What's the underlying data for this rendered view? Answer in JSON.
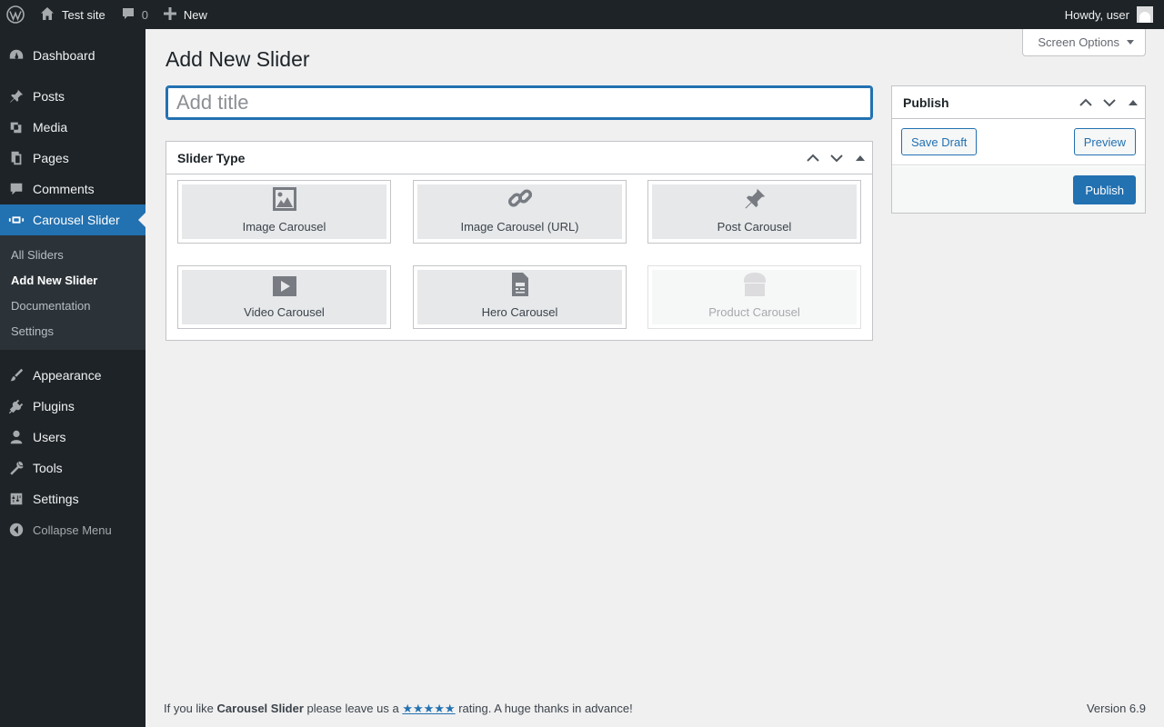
{
  "admin_bar": {
    "site_name": "Test site",
    "comments_count": "0",
    "new_label": "New",
    "greeting": "Howdy, user"
  },
  "sidebar": {
    "items_top": [
      {
        "label": "Dashboard",
        "icon": "dashboard-icon"
      }
    ],
    "items_mid": [
      {
        "label": "Posts",
        "icon": "pushpin-icon"
      },
      {
        "label": "Media",
        "icon": "media-icon"
      },
      {
        "label": "Pages",
        "icon": "pages-icon"
      },
      {
        "label": "Comments",
        "icon": "comments-icon"
      },
      {
        "label": "Carousel Slider",
        "icon": "slides-icon",
        "current": true
      }
    ],
    "submenu": [
      {
        "label": "All Sliders"
      },
      {
        "label": "Add New Slider",
        "current": true
      },
      {
        "label": "Documentation"
      },
      {
        "label": "Settings"
      }
    ],
    "items_bottom": [
      {
        "label": "Appearance",
        "icon": "brush-icon"
      },
      {
        "label": "Plugins",
        "icon": "plugin-icon"
      },
      {
        "label": "Users",
        "icon": "users-icon"
      },
      {
        "label": "Tools",
        "icon": "wrench-icon"
      },
      {
        "label": "Settings",
        "icon": "settings-icon"
      }
    ],
    "collapse_label": "Collapse Menu"
  },
  "screen_options_label": "Screen Options",
  "page_title": "Add New Slider",
  "title_input": {
    "placeholder": "Add title",
    "value": ""
  },
  "slider_type": {
    "heading": "Slider Type",
    "types": [
      {
        "label": "Image Carousel",
        "icon": "image-icon",
        "disabled": false
      },
      {
        "label": "Image Carousel (URL)",
        "icon": "link-icon",
        "disabled": false
      },
      {
        "label": "Post Carousel",
        "icon": "pushpin-icon",
        "disabled": false
      },
      {
        "label": "Video Carousel",
        "icon": "video-icon",
        "disabled": false
      },
      {
        "label": "Hero Carousel",
        "icon": "hero-doc-icon",
        "disabled": false
      },
      {
        "label": "Product Carousel",
        "icon": "store-icon",
        "disabled": true
      }
    ]
  },
  "publish": {
    "heading": "Publish",
    "save_draft_label": "Save Draft",
    "preview_label": "Preview",
    "publish_label": "Publish"
  },
  "footer": {
    "text_before": "If you like ",
    "plugin_name": "Carousel Slider",
    "text_middle": " please leave us a ",
    "rating_link": "★★★★★",
    "text_after": " rating. A huge thanks in advance!",
    "version": "Version 6.9"
  },
  "colors": {
    "accent": "#2271b1",
    "admin_dark": "#1d2327",
    "background": "#f0f0f1"
  }
}
